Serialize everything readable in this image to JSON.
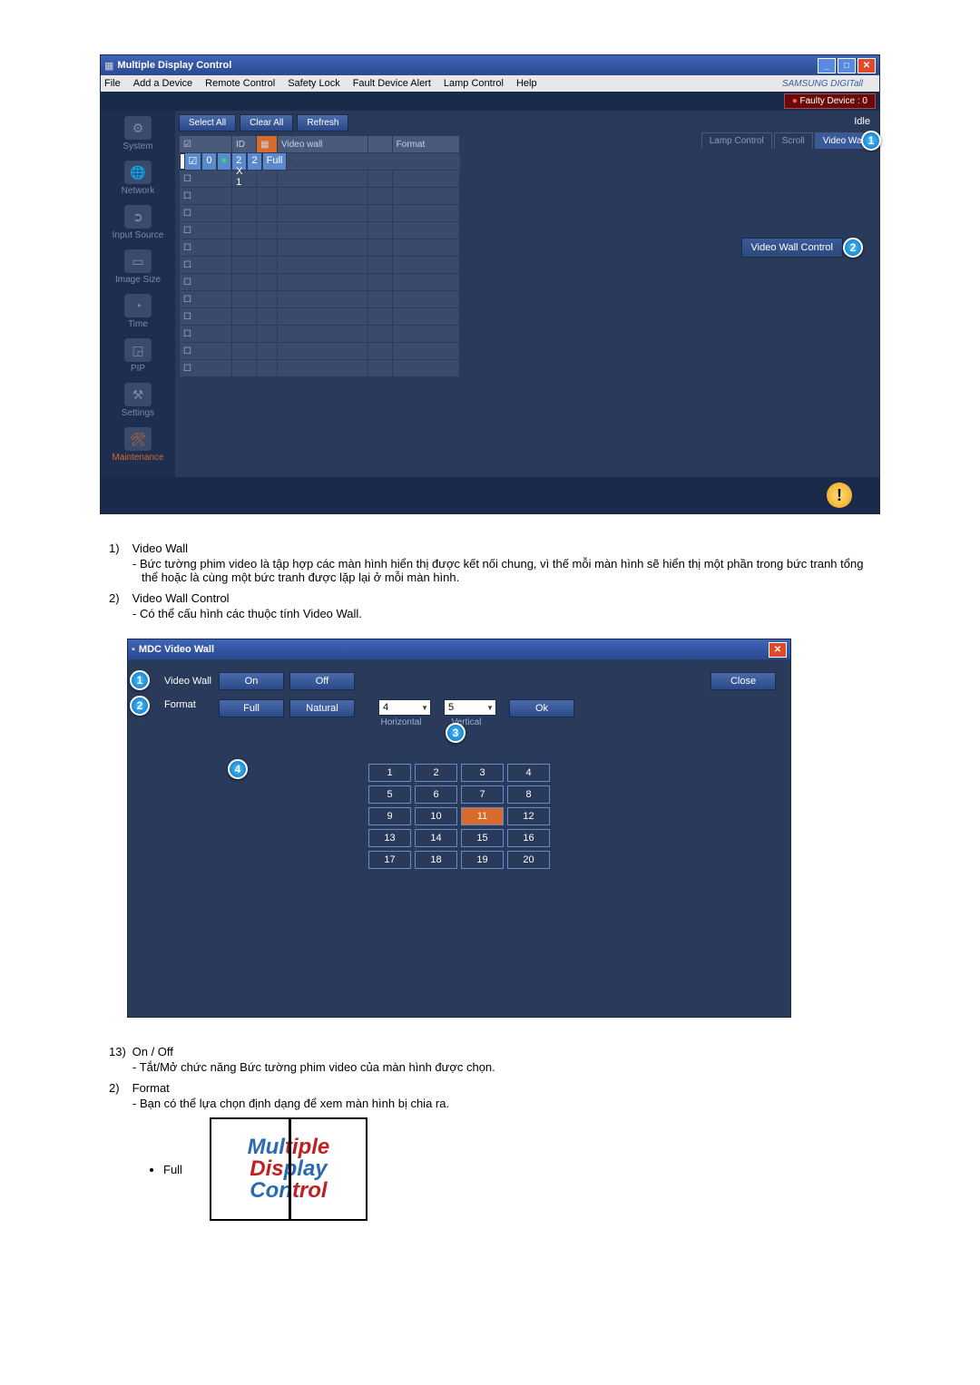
{
  "app1": {
    "title": "Multiple Display Control",
    "menu": [
      "File",
      "Add a Device",
      "Remote Control",
      "Safety Lock",
      "Fault Device Alert",
      "Lamp Control",
      "Help"
    ],
    "brand": "SAMSUNG DIGITall",
    "fault": "Faulty Device : 0",
    "buttons": {
      "selectAll": "Select All",
      "clearAll": "Clear All",
      "refresh": "Refresh"
    },
    "status": "Idle",
    "tabs": {
      "lamp": "Lamp Control",
      "scroll": "Scroll",
      "video": "Video Wall"
    },
    "table": {
      "headers": {
        "id": "ID",
        "vw": "Video wall",
        "fmt": "Format"
      },
      "row": {
        "id": "0",
        "vw": "2 X 1",
        "vwn": "2",
        "fmt": "Full"
      }
    },
    "sidebar": {
      "system": "System",
      "network": "Network",
      "input": "Input Source",
      "image": "Image Size",
      "time": "Time",
      "pip": "PIP",
      "settings": "Settings",
      "maint": "Maintenance"
    },
    "vwControl": "Video Wall Control"
  },
  "desc1": {
    "n1": "1)",
    "t1": "Video Wall",
    "s1": "- Bức tường phim video là tập hợp các màn hình hiển thị được kết nối chung, vì thế mỗi màn hình sẽ hiển thị một phần trong bức tranh tổng thể hoặc là cùng một bức tranh được lặp lại ở mỗi màn hình.",
    "n2": "2)",
    "t2": "Video Wall Control",
    "s2": "- Có thể cấu hình các thuộc tính Video Wall."
  },
  "dlg": {
    "title": "MDC Video Wall",
    "labels": {
      "vw": "Video Wall",
      "fmt": "Format",
      "h": "Horizontal",
      "v": "Vertical"
    },
    "btns": {
      "on": "On",
      "off": "Off",
      "full": "Full",
      "natural": "Natural",
      "close": "Close",
      "ok": "Ok"
    },
    "sel": {
      "h": "4",
      "v": "5"
    },
    "cells": [
      "1",
      "2",
      "3",
      "4",
      "5",
      "6",
      "7",
      "8",
      "9",
      "10",
      "11",
      "12",
      "13",
      "14",
      "15",
      "16",
      "17",
      "18",
      "19",
      "20"
    ],
    "selected_cell": "11"
  },
  "desc2": {
    "n1": "13)",
    "t1": "On / Off",
    "s1": "- Tắt/Mở chức năng Bức tường phim video của màn hình được chọn.",
    "n2": "2)",
    "t2": "Format",
    "s2": "- Bạn có thể lựa chọn định dạng để xem màn hình bị chia ra.",
    "bullet": "Full",
    "img": {
      "l1a": "Mul",
      "l1b": "tiple",
      "l2a": "Dis",
      "l2b": "play",
      "l3a": "Con",
      "l3b": "trol"
    }
  }
}
